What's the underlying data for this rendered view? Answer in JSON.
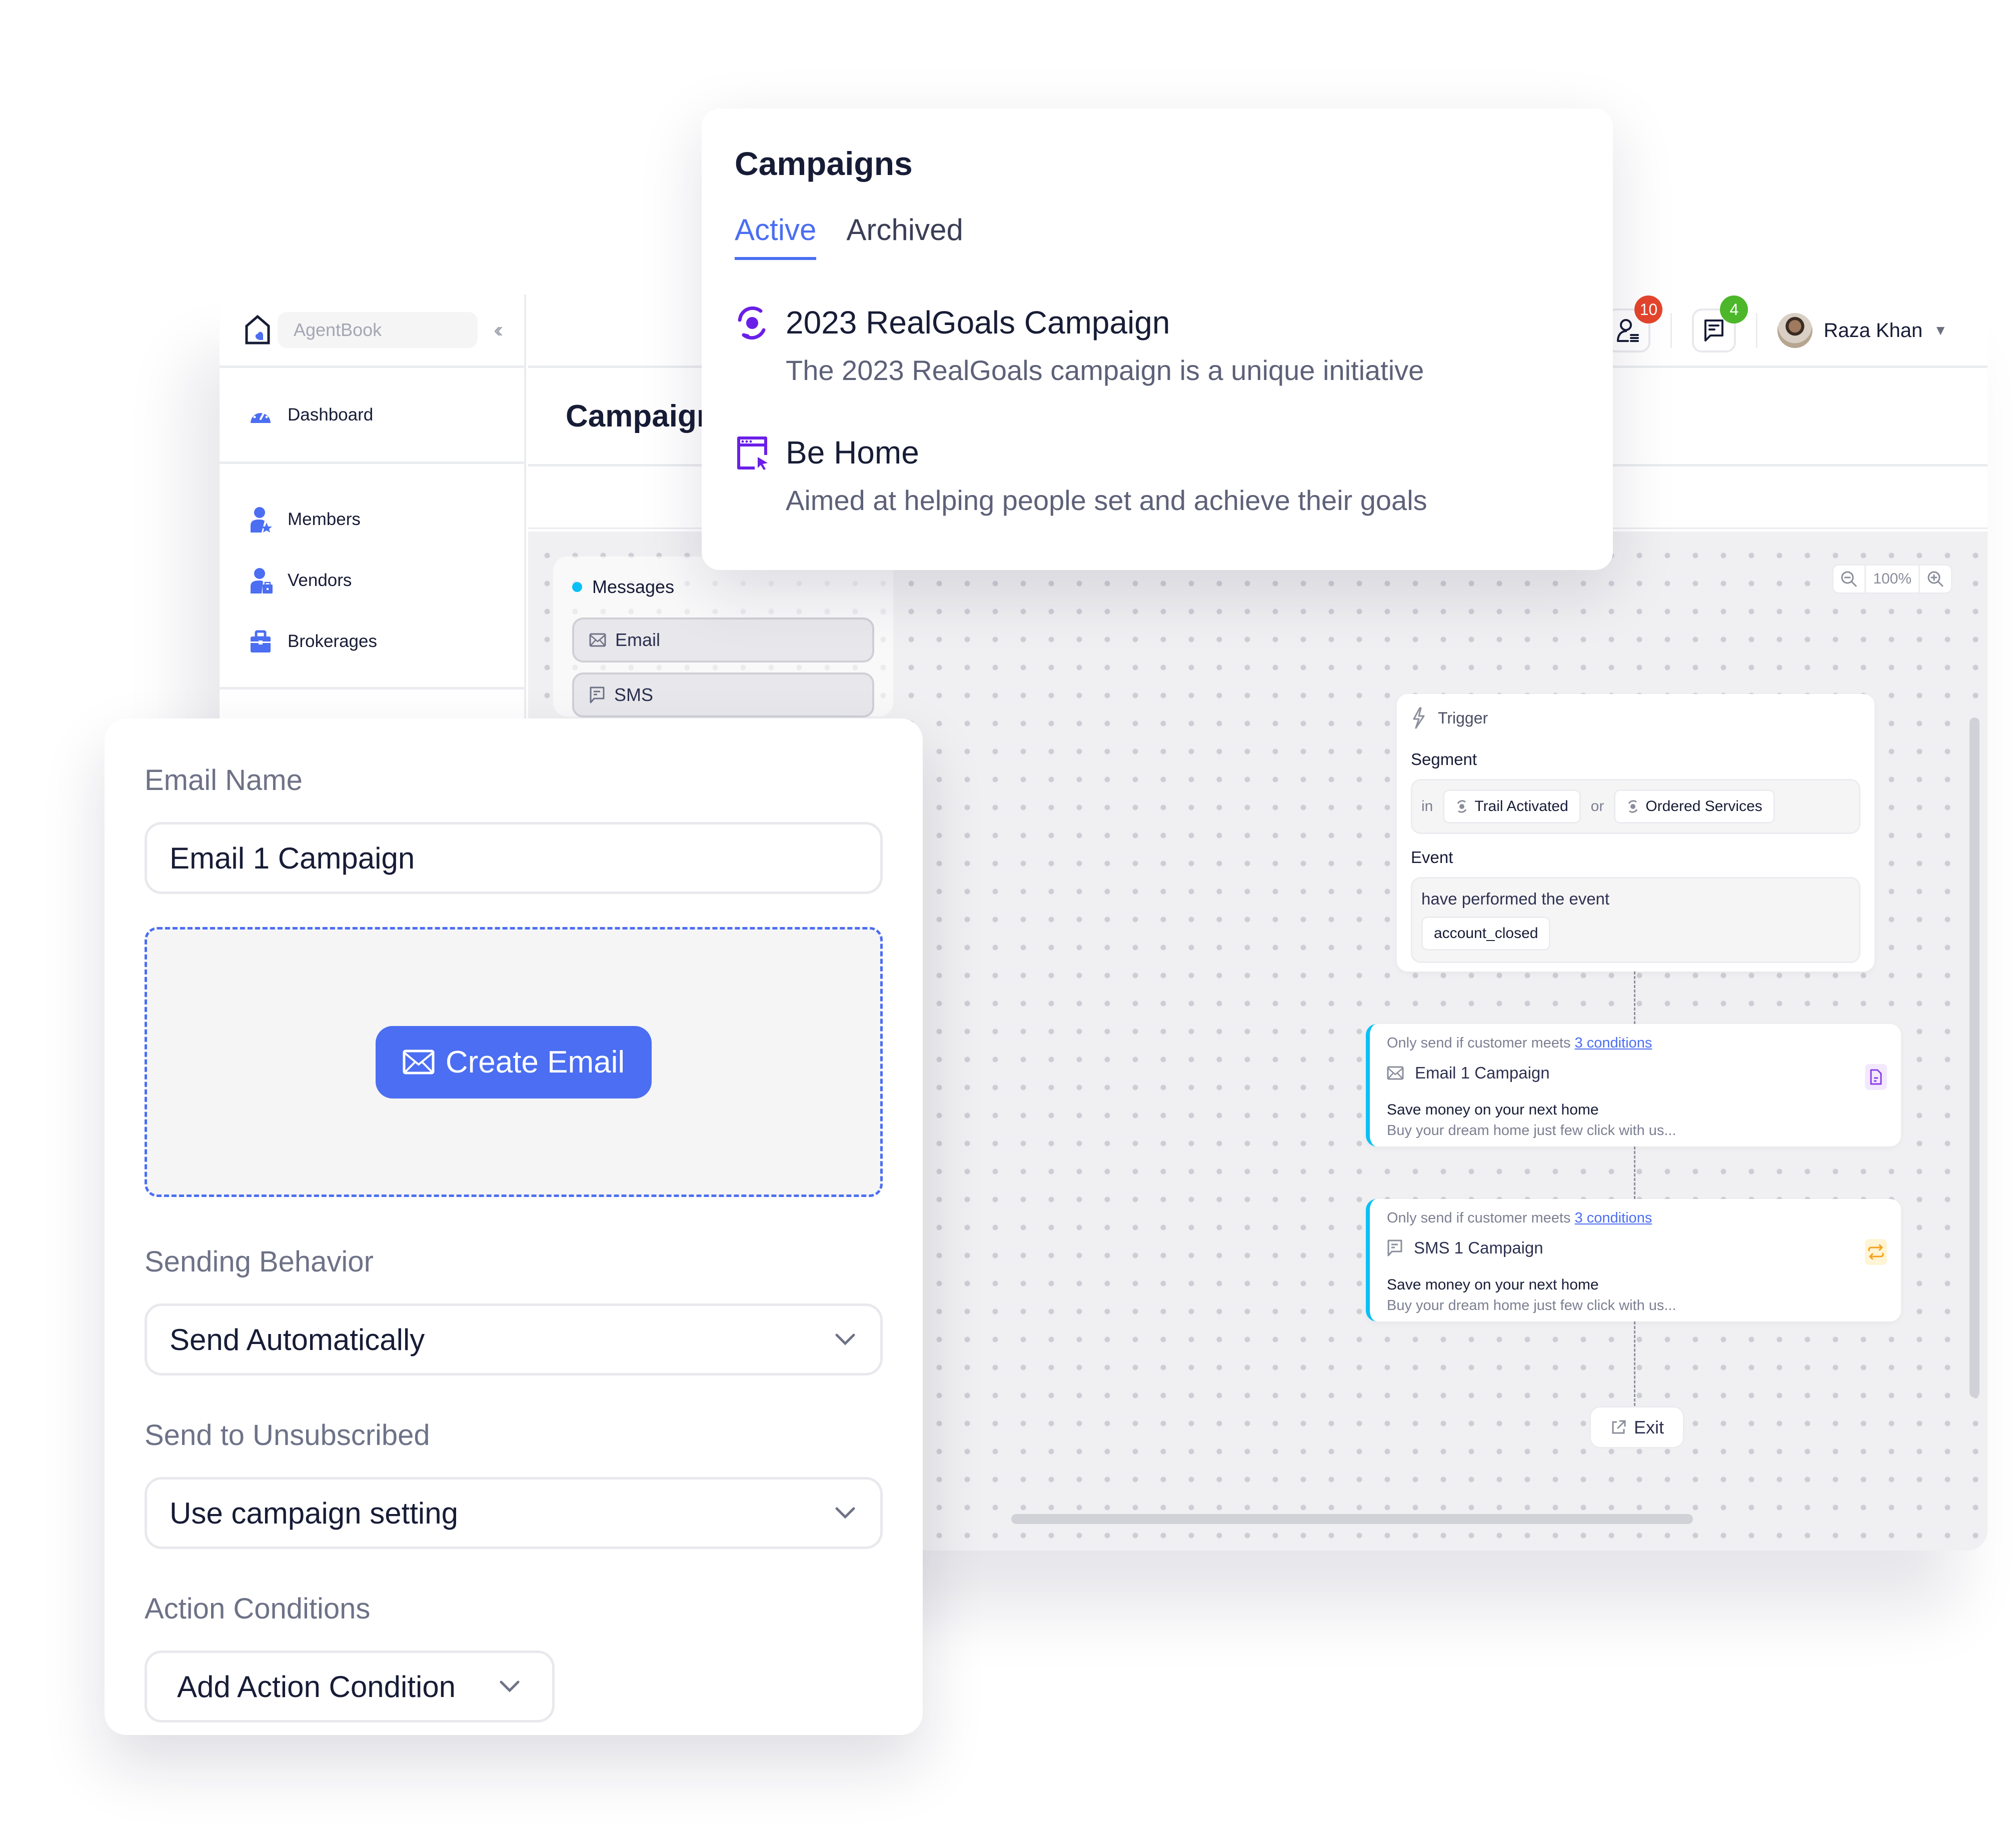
{
  "app": {
    "brand": "AgentBook",
    "collapse_icon": "double-chevron-left",
    "page_title": "Campaign",
    "sidebar": {
      "items": [
        {
          "label": "Dashboard",
          "icon": "dashboard-gauge"
        },
        {
          "label": "Members",
          "icon": "member-star"
        },
        {
          "label": "Vendors",
          "icon": "vendor-briefcase"
        },
        {
          "label": "Brokerages",
          "icon": "briefcase"
        }
      ]
    },
    "header": {
      "contacts_badge": "10",
      "messages_badge": "4",
      "user_name": "Raza Khan",
      "colors": {
        "red_badge": "#e5452c",
        "green_badge": "#4cb72a"
      }
    }
  },
  "canvas": {
    "palette": {
      "title": "Messages",
      "items": [
        {
          "label": "Email",
          "icon": "mail"
        },
        {
          "label": "SMS",
          "icon": "chat"
        }
      ]
    },
    "zoom": {
      "level": "100%"
    },
    "trigger": {
      "title": "Trigger",
      "segment_label": "Segment",
      "segment_prefix": "in",
      "segment_joiner": "or",
      "segments": [
        "Trail Activated",
        "Ordered Services"
      ],
      "event_label": "Event",
      "event_text": "have performed the event",
      "event_name": "account_closed"
    },
    "messages": [
      {
        "condition_prefix": "Only send if customer meets",
        "condition_link": "3 conditions",
        "title": "Email 1 Campaign",
        "icon": "mail",
        "tag_icon": "document",
        "subject": "Save money on your next home",
        "preview": "Buy your dream home just few click with us..."
      },
      {
        "condition_prefix": "Only send if customer meets",
        "condition_link": "3 conditions",
        "title": "SMS 1 Campaign",
        "icon": "chat",
        "tag_icon": "repeat",
        "subject": "Save money on your next home",
        "preview": "Buy your dream home just few click with us..."
      }
    ],
    "exit_label": "Exit"
  },
  "campaigns_popup": {
    "title": "Campaigns",
    "tabs": [
      {
        "label": "Active",
        "active": true
      },
      {
        "label": "Archived",
        "active": false
      }
    ],
    "items": [
      {
        "name": "2023 RealGoals Campaign",
        "description": "The 2023 RealGoals campaign is a unique initiative",
        "icon": "target-refresh"
      },
      {
        "name": "Be Home",
        "description": "Aimed at helping people set and achieve their goals",
        "icon": "browser-cursor"
      }
    ],
    "accent": "#4b6ef2",
    "icon_color": "#6a1fe8"
  },
  "email_form": {
    "name_label": "Email Name",
    "name_value": "Email 1 Campaign",
    "create_button": "Create Email",
    "sending_label": "Sending Behavior",
    "sending_value": "Send Automatically",
    "unsub_label": "Send to Unsubscribed",
    "unsub_value": "Use campaign setting",
    "conditions_label": "Action Conditions",
    "conditions_button": "Add Action Condition"
  }
}
